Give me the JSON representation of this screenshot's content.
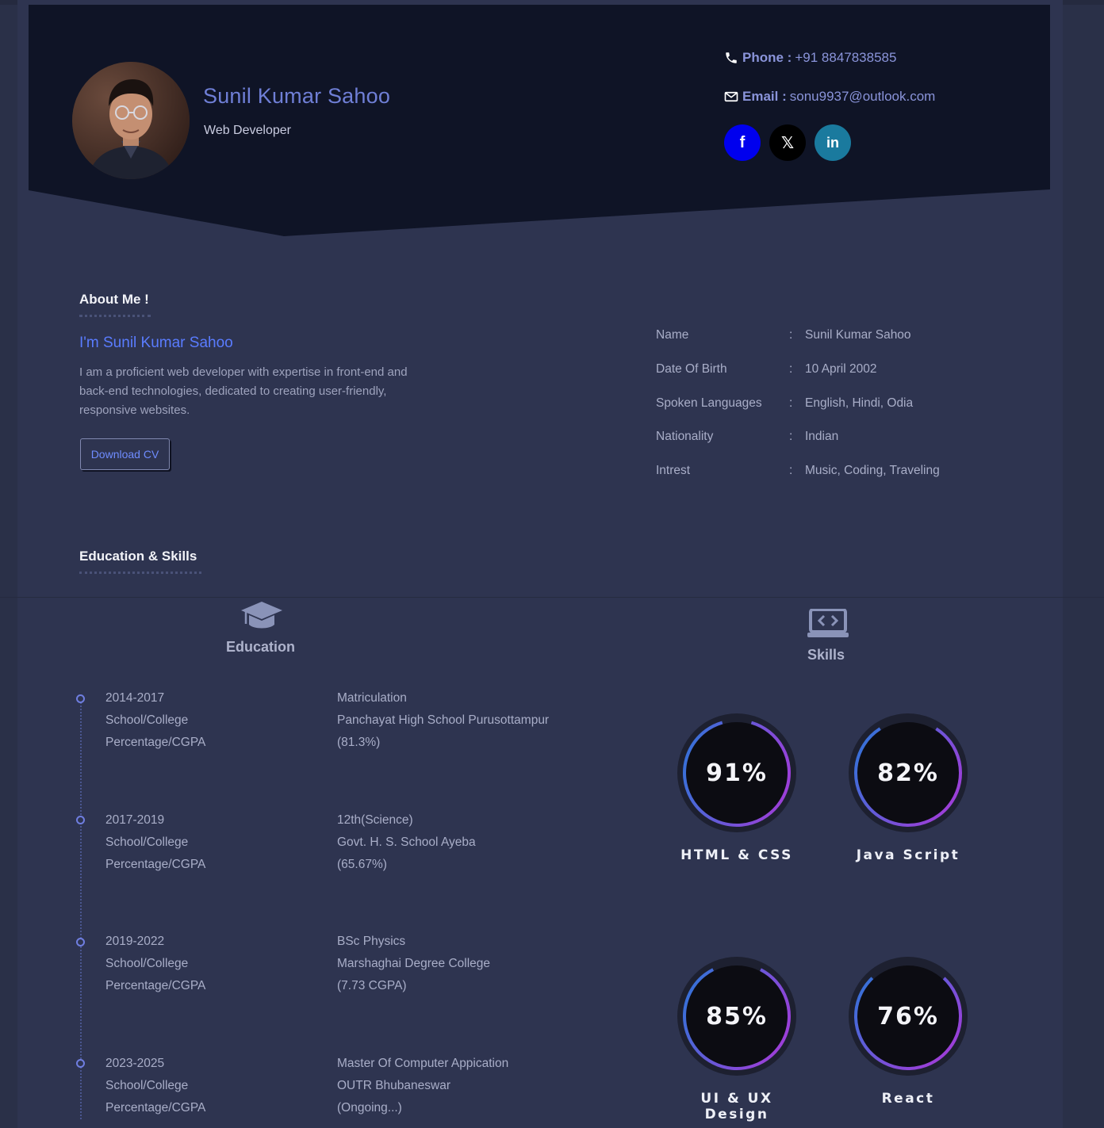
{
  "header": {
    "name": "Sunil Kumar Sahoo",
    "role": "Web Developer",
    "phone_label": "Phone :",
    "phone_value": "+91 8847838585",
    "email_label": "Email :",
    "email_value": "sonu9937@outlook.com",
    "socials": [
      {
        "name": "facebook",
        "glyph": "f",
        "color": "#0000ee"
      },
      {
        "name": "x",
        "glyph": "𝕏",
        "color": "#000000"
      },
      {
        "name": "linkedin",
        "glyph": "in",
        "color": "#1a7a9e"
      }
    ]
  },
  "about": {
    "heading": "About Me !",
    "intro": "I'm Sunil Kumar Sahoo",
    "text": "I am a proficient web developer with expertise in front-end and back-end technologies, dedicated to creating user-friendly, responsive websites.",
    "download_label": "Download CV",
    "details": [
      {
        "key": "Name",
        "sep": ":",
        "value": "Sunil Kumar Sahoo"
      },
      {
        "key": "Date Of Birth",
        "sep": ":",
        "value": "10 April 2002"
      },
      {
        "key": "Spoken Languages",
        "sep": ":",
        "value": "English, Hindi, Odia"
      },
      {
        "key": "Nationality",
        "sep": ":",
        "value": "Indian"
      },
      {
        "key": "Intrest",
        "sep": ":",
        "value": "Music, Coding, Traveling"
      }
    ]
  },
  "education_skills": {
    "heading": "Education & Skills",
    "education_title": "Education",
    "skills_title": "Skills",
    "education": [
      {
        "years": "2014-2017",
        "l2": "School/College",
        "l3": "Percentage/CGPA",
        "degree": "Matriculation",
        "school": "Panchayat High School Purusottampur",
        "score": "(81.3%)"
      },
      {
        "years": "2017-2019",
        "l2": "School/College",
        "l3": "Percentage/CGPA",
        "degree": "12th(Science)",
        "school": "Govt. H. S. School Ayeba",
        "score": "(65.67%)"
      },
      {
        "years": "2019-2022",
        "l2": "School/College",
        "l3": "Percentage/CGPA",
        "degree": "BSc Physics",
        "school": "Marshaghai Degree College",
        "score": "(7.73 CGPA)"
      },
      {
        "years": "2023-2025",
        "l2": "School/College",
        "l3": "Percentage/CGPA",
        "degree": "Master Of Computer Appication",
        "school": "OUTR Bhubaneswar",
        "score": "(Ongoing...)"
      }
    ],
    "skills": [
      {
        "label": "HTML & CSS",
        "percent_text": "91%",
        "level": 0.91
      },
      {
        "label": "Java Script",
        "percent_text": "82%",
        "level": 0.82
      },
      {
        "label": "UI & UX Design",
        "percent_text": "85%",
        "level": 0.85
      },
      {
        "label": "React",
        "percent_text": "76%",
        "level": 0.76
      }
    ]
  },
  "colors": {
    "accent": "#5a7cff",
    "header_bg": "#0f1426",
    "ring_start": "#3a6fd8",
    "ring_end": "#9b3fd8"
  }
}
